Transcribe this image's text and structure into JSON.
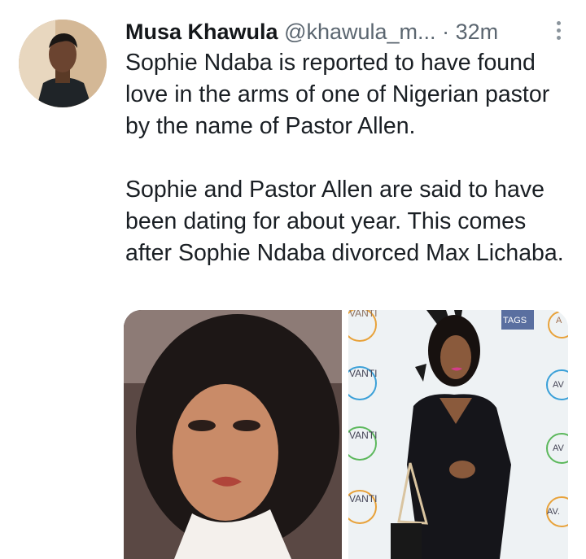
{
  "tweet": {
    "author_name": "Musa Khawula",
    "handle": "@khawula_m...",
    "separator": "·",
    "time": "32m",
    "paragraphs": [
      "Sophie Ndaba is reported to have found love in the arms of one of Nigerian pastor by the name of Pastor Allen.",
      "Sophie and Pastor Allen are said to have been dating for about year. This comes after Sophie Ndaba divorced Max Lichaba."
    ],
    "icons": {
      "more": "more-vertical-icon"
    }
  },
  "media": {
    "backdrop_logos": [
      "VANTI",
      "VANTI",
      "VANTI",
      "VANTI"
    ],
    "backdrop_right": [
      "A",
      "AV",
      "AV",
      "AV."
    ],
    "backdrop_top": "TAGS"
  },
  "colors": {
    "text": "#14171a",
    "secondary": "#5b6670",
    "background": "#ffffff"
  }
}
